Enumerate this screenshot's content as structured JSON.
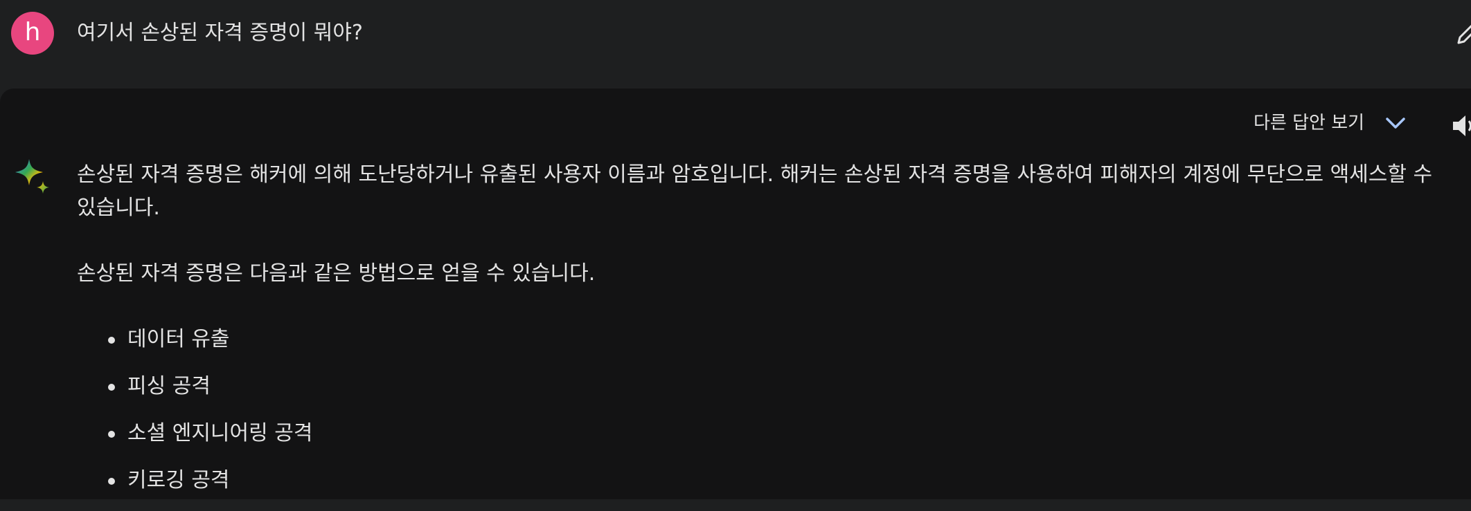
{
  "user": {
    "avatar_letter": "h",
    "avatar_color": "#e8467f",
    "query": "여기서 손상된 자격 증명이 뭐야?"
  },
  "response": {
    "drafts_label": "다른 답안 보기",
    "paragraphs": [
      "손상된 자격 증명은 해커에 의해 도난당하거나 유출된 사용자 이름과 암호입니다. 해커는 손상된 자격 증명을 사용하여 피해자의 계정에 무단으로 액세스할 수 있습니다.",
      "손상된 자격 증명은 다음과 같은 방법으로 얻을 수 있습니다."
    ],
    "bullets": [
      "데이터 유출",
      "피싱 공격",
      "소셜 엔지니어링 공격",
      "키로깅 공격"
    ]
  },
  "icons": {
    "edit": "pencil-icon",
    "chevron": "chevron-down-icon",
    "speaker": "speaker-icon",
    "sparkle": "sparkle-icon"
  },
  "colors": {
    "top_background": "#1e1f20",
    "panel_background": "#131314",
    "text": "#e3e3e3",
    "accent_blue": "#a8c7fa"
  }
}
